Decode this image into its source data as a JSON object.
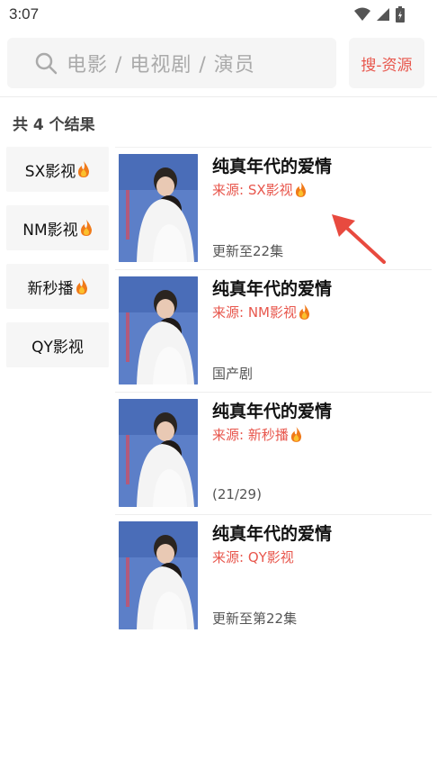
{
  "status": {
    "time": "3:07"
  },
  "search": {
    "placeholder": "电影 / 电视剧 / 演员",
    "button_label": "搜-资源"
  },
  "result_count": "共 4 个结果",
  "sources": [
    {
      "label": "SX影视",
      "hot": true
    },
    {
      "label": "NM影视",
      "hot": true
    },
    {
      "label": "新秒播",
      "hot": true
    },
    {
      "label": "QY影视",
      "hot": false
    }
  ],
  "results": [
    {
      "title": "纯真年代的爱情",
      "source": "来源: SX影视",
      "hot": true,
      "note": "更新至22集"
    },
    {
      "title": "纯真年代的爱情",
      "source": "来源: NM影视",
      "hot": true,
      "note": "国产剧"
    },
    {
      "title": "纯真年代的爱情",
      "source": "来源: 新秒播",
      "hot": true,
      "note": "(21/29)"
    },
    {
      "title": "纯真年代的爱情",
      "source": "来源: QY影视",
      "hot": false,
      "note": "更新至第22集"
    }
  ],
  "colors": {
    "accent": "#e8574d",
    "flame": "#f07a1a"
  }
}
